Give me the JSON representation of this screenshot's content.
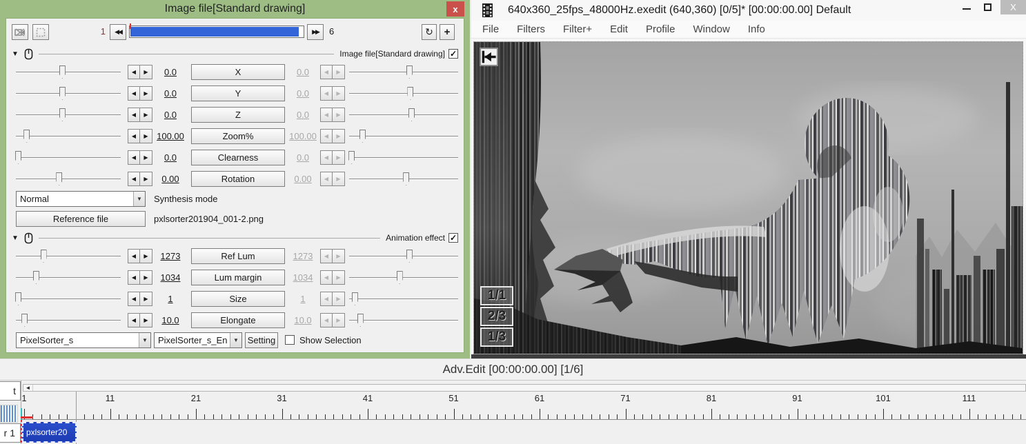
{
  "colors": {
    "dialog_green": "#9dbd85",
    "close_red": "#c9504b",
    "track_blue": "#3465d8",
    "clip_blue": "#1c3bb4",
    "playhead_red": "#e03030"
  },
  "settings": {
    "title": "Image file[Standard drawing]",
    "trackbar": {
      "start": "1",
      "end": "6"
    },
    "header_main": {
      "label": "Image file[Standard drawing]"
    },
    "header_anim": {
      "label": "Animation effect"
    },
    "params": [
      {
        "label": "X",
        "left": "0.0",
        "right": "0.0",
        "lpos": 44,
        "rpos": 55
      },
      {
        "label": "Y",
        "left": "0.0",
        "right": "0.0",
        "lpos": 44,
        "rpos": 56
      },
      {
        "label": "Z",
        "left": "0.0",
        "right": "0.0",
        "lpos": 44,
        "rpos": 57
      },
      {
        "label": "Zoom%",
        "left": "100.00",
        "right": "100.00",
        "lpos": 10,
        "rpos": 12
      },
      {
        "label": "Clearness",
        "left": "0.0",
        "right": "0.0",
        "lpos": 2,
        "rpos": 2
      },
      {
        "label": "Rotation",
        "left": "0.00",
        "right": "0.00",
        "lpos": 41,
        "rpos": 52
      }
    ],
    "anim_params": [
      {
        "label": "Ref Lum",
        "left": "1273",
        "right": "1273",
        "lpos": 26,
        "rpos": 55
      },
      {
        "label": "Lum margin",
        "left": "1034",
        "right": "1034",
        "lpos": 19,
        "rpos": 46
      },
      {
        "label": "Size",
        "left": "1",
        "right": "1",
        "lpos": 2,
        "rpos": 5
      },
      {
        "label": "Elongate",
        "left": "10.0",
        "right": "10.0",
        "lpos": 8,
        "rpos": 10
      }
    ],
    "synthesis": {
      "value": "Normal",
      "label": "Synthesis mode"
    },
    "reference": {
      "button_label": "Reference file",
      "filename": "pxlsorter201904_001-2.png"
    },
    "footer": {
      "script_select": "PixelSorter_s",
      "script_select2": "PixelSorter_s_En",
      "setting_button": "Setting",
      "show_selection_label": "Show Selection"
    }
  },
  "main_window": {
    "title": "640x360_25fps_48000Hz.exedit (640,360)  [0/5]* [00:00:00.00]  Default",
    "menu": [
      "File",
      "Filters",
      "Filter+",
      "Edit",
      "Profile",
      "Window",
      "Info"
    ],
    "preview_overlays": [
      "1/1",
      "2/3",
      "1/3"
    ]
  },
  "advedit_bar": {
    "title": "Adv.Edit [00:00:00.00] [1/6]"
  },
  "timeline": {
    "ruler_labels": [
      "1",
      "11",
      "21",
      "31",
      "41",
      "51",
      "61",
      "71",
      "81",
      "91",
      "101",
      "111"
    ],
    "clip_label": "pxlsorter20",
    "layer_label": "r 1",
    "corner_label": "t"
  },
  "icons": {
    "close": "x",
    "close_main": "X",
    "prev": "◀◀",
    "next": "▶▶",
    "refresh": "↻",
    "add": "+",
    "collapse": "▼",
    "dropdown": "▼",
    "spin_left": "◀",
    "spin_right": "▶",
    "check": "✓",
    "scroll_left": "◄"
  }
}
